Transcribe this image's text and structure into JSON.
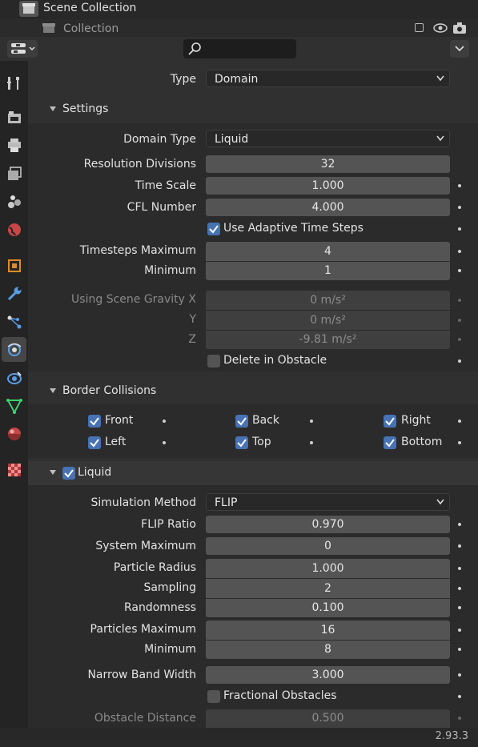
{
  "outliner": {
    "row1": "Scene Collection",
    "row2": "Collection"
  },
  "header": {
    "search_placeholder": ""
  },
  "status": {
    "version": "2.93.3"
  },
  "type": {
    "label": "Type",
    "value": "Domain"
  },
  "settings": {
    "title": "Settings",
    "domain_type_label": "Domain Type",
    "domain_type_value": "Liquid",
    "resolution_label": "Resolution Divisions",
    "resolution_value": "32",
    "time_scale_label": "Time Scale",
    "time_scale_value": "1.000",
    "cfl_label": "CFL Number",
    "cfl_value": "4.000",
    "adaptive_label": "Use Adaptive Time Steps",
    "timesteps_max_label": "Timesteps Maximum",
    "timesteps_max_value": "4",
    "minimum_label": "Minimum",
    "minimum_value": "1",
    "gravity_x_label": "Using Scene Gravity X",
    "gravity_x_value": "0 m/s²",
    "gravity_y_label": "Y",
    "gravity_y_value": "0 m/s²",
    "gravity_z_label": "Z",
    "gravity_z_value": "-9.81 m/s²",
    "delete_label": "Delete in Obstacle"
  },
  "border": {
    "title": "Border Collisions",
    "front": "Front",
    "back": "Back",
    "right": "Right",
    "left": "Left",
    "top": "Top",
    "bottom": "Bottom"
  },
  "liquid": {
    "title": "Liquid",
    "sim_method_label": "Simulation Method",
    "sim_method_value": "FLIP",
    "flip_ratio_label": "FLIP Ratio",
    "flip_ratio_value": "0.970",
    "system_max_label": "System Maximum",
    "system_max_value": "0",
    "particle_radius_label": "Particle Radius",
    "particle_radius_value": "1.000",
    "sampling_label": "Sampling",
    "sampling_value": "2",
    "randomness_label": "Randomness",
    "randomness_value": "0.100",
    "particles_max_label": "Particles Maximum",
    "particles_max_value": "16",
    "min_label": "Minimum",
    "min_value": "8",
    "narrow_band_label": "Narrow Band Width",
    "narrow_band_value": "3.000",
    "fractional_label": "Fractional Obstacles",
    "obstacle_dist_label": "Obstacle Distance",
    "obstacle_dist_value": "0.500"
  },
  "colors": {
    "accent": "#4772b3",
    "field": "#545454",
    "panel": "#303030"
  }
}
